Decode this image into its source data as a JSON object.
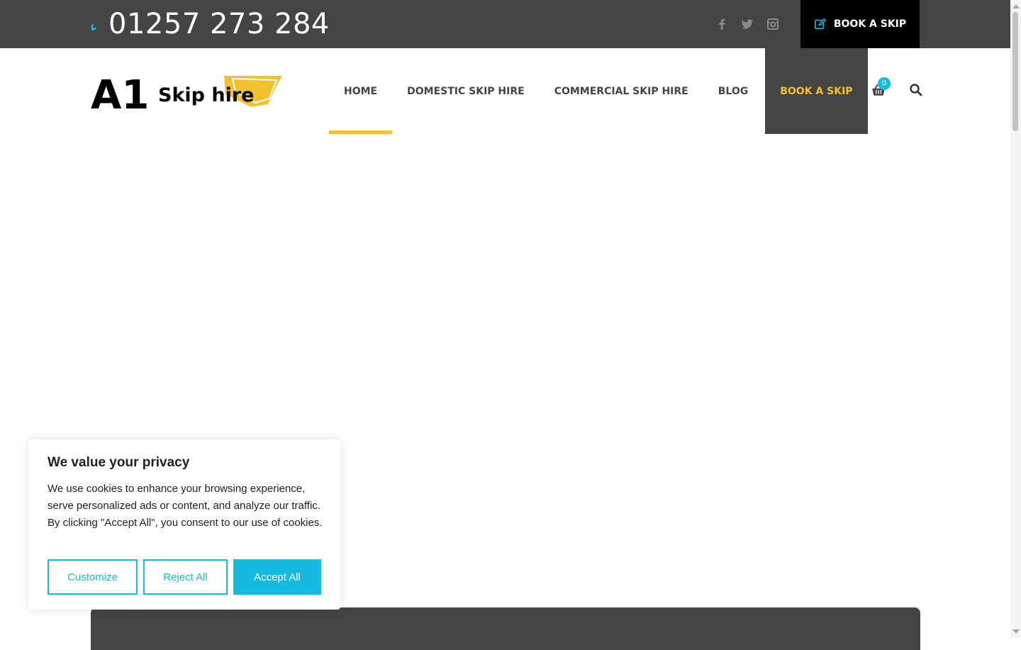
{
  "topbar": {
    "phone": "01257 273 284",
    "socials": [
      "facebook-icon",
      "twitter-icon",
      "instagram-icon"
    ],
    "book_label": "BOOK A SKIP"
  },
  "logo": {
    "text_a1": "A1",
    "text_skip": "Skip hire"
  },
  "nav": {
    "items": [
      {
        "label": "HOME",
        "active": true
      },
      {
        "label": "DOMESTIC SKIP HIRE"
      },
      {
        "label": "COMMERCIAL SKIP HIRE"
      },
      {
        "label": "BLOG"
      },
      {
        "label": "BOOK A SKIP",
        "highlight": true
      }
    ],
    "cart_count": "0"
  },
  "cookie": {
    "title": "We value your privacy",
    "body": "We use cookies to enhance your browsing experience, serve personalized ads or content, and analyze our traffic. By clicking \"Accept All\", you consent to our use of cookies.",
    "customize": "Customize",
    "reject": "Reject All",
    "accept": "Accept All"
  },
  "colors": {
    "dark": "#444444",
    "accent_yellow": "#f2c12e",
    "accent_blue": "#16b9e0",
    "black": "#000000"
  }
}
